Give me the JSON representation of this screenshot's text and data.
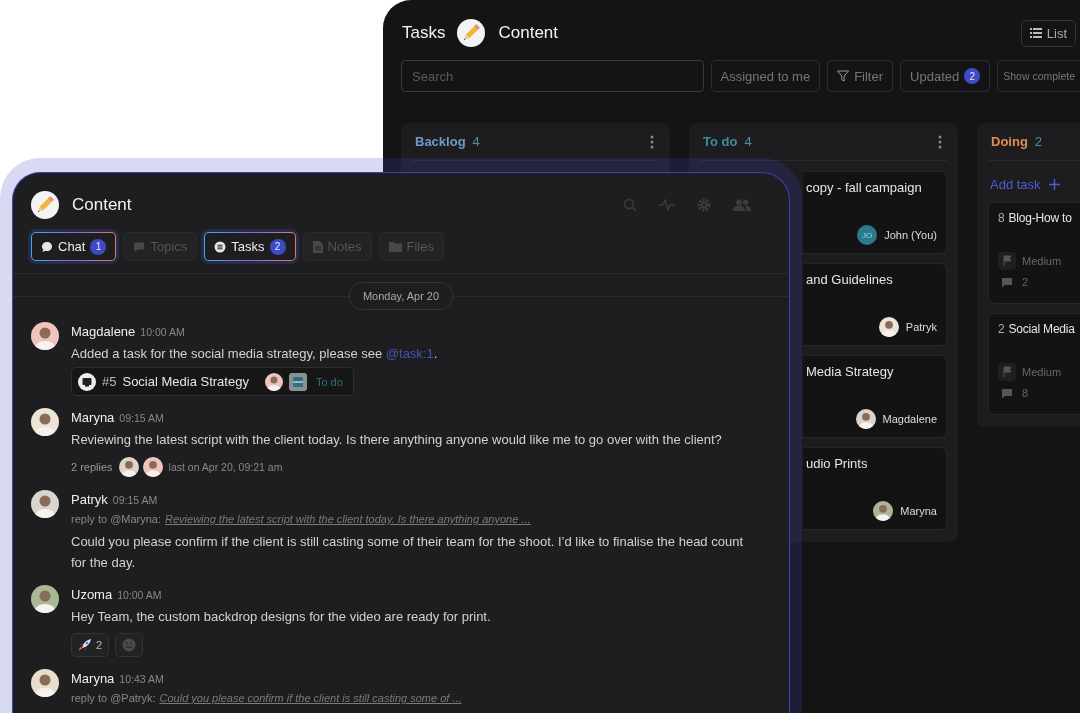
{
  "board": {
    "title": "Tasks",
    "project": "Content",
    "view_button": "List",
    "search": {
      "placeholder": "Search"
    },
    "filters": [
      {
        "label": "Assigned to me",
        "kind": "plain"
      },
      {
        "label": "Filter",
        "kind": "filter"
      },
      {
        "label": "Updated",
        "kind": "count",
        "count": "2"
      },
      {
        "label": "Show complete",
        "kind": "small"
      }
    ],
    "columns": [
      {
        "name": "Backlog",
        "count": "4",
        "color": "#6b9cc8",
        "menu": true
      },
      {
        "name": "To do",
        "count": "4",
        "color": "#3d8c9c",
        "menu": true,
        "cards": [
          {
            "kind": "assigned",
            "title": "copy - fall campaign",
            "assignee": "John (You)",
            "initials": "JO"
          },
          {
            "kind": "assigned",
            "title": "and Guidelines",
            "assignee": "Patryk"
          },
          {
            "kind": "assigned",
            "title": "Media Strategy",
            "assignee": "Magdalene"
          },
          {
            "kind": "assigned",
            "title": "udio Prints",
            "assignee": "Maryna"
          }
        ]
      },
      {
        "name": "Doing",
        "count": "2",
        "color": "#e08c52",
        "menu": false,
        "add_task": "Add task",
        "cards": [
          {
            "kind": "detailed",
            "number": "8",
            "title": "Blog-How to",
            "priority": "Medium",
            "comments": "2"
          },
          {
            "kind": "detailed",
            "number": "2",
            "title": "Social Media",
            "priority": "Medium",
            "comments": "8"
          }
        ]
      }
    ]
  },
  "chat": {
    "title": "Content",
    "tabs": [
      {
        "label": "Chat",
        "count": "1",
        "selected": true,
        "kind": "chat"
      },
      {
        "label": "Topics",
        "selected": false,
        "kind": "topics"
      },
      {
        "label": "Tasks",
        "count": "2",
        "selected": true,
        "kind": "tasks"
      },
      {
        "label": "Notes",
        "selected": false,
        "kind": "notes"
      },
      {
        "label": "Files",
        "selected": false,
        "kind": "files"
      }
    ],
    "date": "Monday, Apr 20",
    "messages": [
      {
        "author": "Magdalene",
        "time": "10:00 AM",
        "text": "Added a task for the social media strategy, please see ",
        "link": "@task:1",
        "text_after": ".",
        "task": {
          "number": "#5",
          "title": "Social Media Strategy",
          "status": "To do"
        }
      },
      {
        "author": "Maryna",
        "time": "09:15 AM",
        "text": "Reviewing the latest script with the client today. Is there anything anyone would like me to go over with the client?",
        "replies": {
          "count": "2 replies",
          "last": "last on Apr 20, 09:21 am"
        }
      },
      {
        "author": "Patryk",
        "time": "09:15 AM",
        "reply_to": "reply to @Maryna:",
        "quote": "Reviewing the latest script with the client today. Is there anything anyone ...",
        "text": "Could you please confirm if the client is still casting some of their team for the shoot. I’d like to finalise the head count for the day."
      },
      {
        "author": "Uzoma",
        "time": "10:00 AM",
        "text": "Hey Team, the custom backdrop designs for the video are ready for print.",
        "reactions": [
          {
            "count": "2"
          }
        ]
      },
      {
        "author": "Maryna",
        "time": "10:43 AM",
        "reply_to": "reply to @Patryk:",
        "quote": "Could you please confirm if the client is still casting some of ..."
      }
    ]
  }
}
